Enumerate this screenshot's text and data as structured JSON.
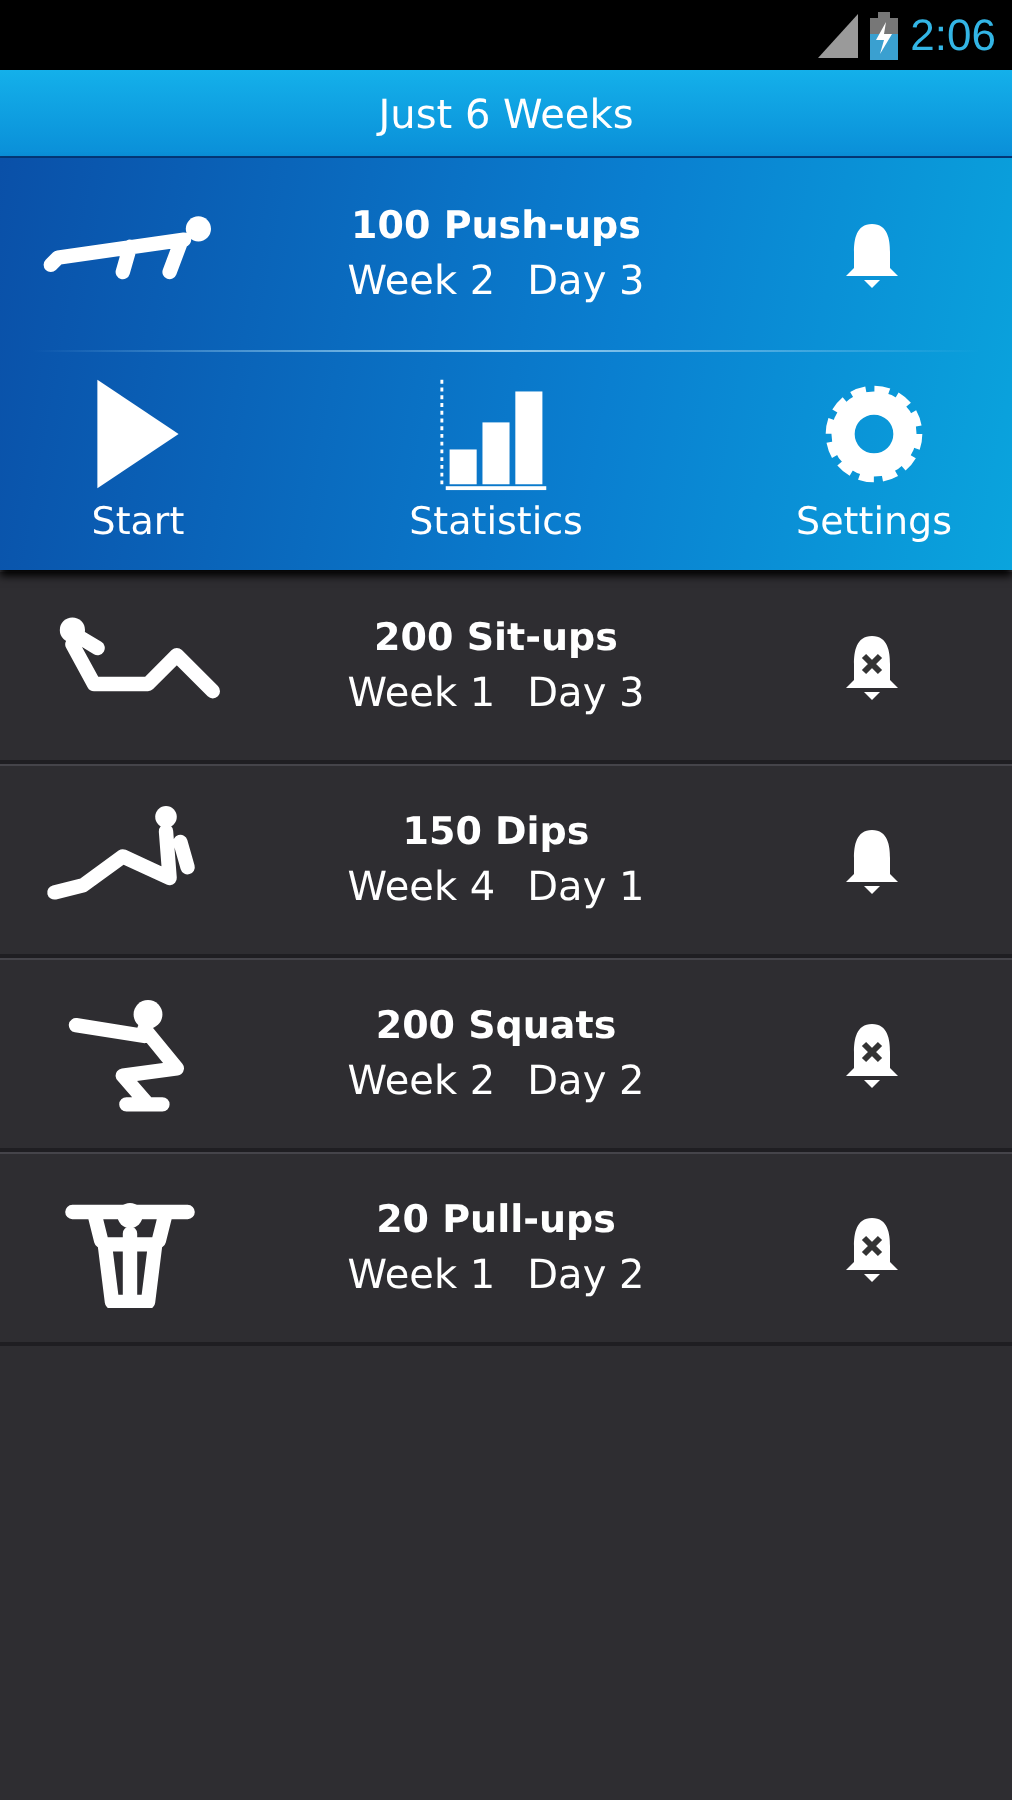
{
  "status_bar": {
    "time": "2:06"
  },
  "title": "Just 6 Weeks",
  "current": {
    "kind": "pushup",
    "name": "100 Push-ups",
    "week": "Week 2",
    "day": "Day 3",
    "reminder": true
  },
  "actions": [
    {
      "kind": "start",
      "label": "Start"
    },
    {
      "kind": "statistics",
      "label": "Statistics"
    },
    {
      "kind": "settings",
      "label": "Settings"
    }
  ],
  "programs": [
    {
      "kind": "situp",
      "name": "200 Sit-ups",
      "week": "Week 1",
      "day": "Day 3",
      "reminder": false
    },
    {
      "kind": "dip",
      "name": "150 Dips",
      "week": "Week 4",
      "day": "Day 1",
      "reminder": true
    },
    {
      "kind": "squat",
      "name": "200 Squats",
      "week": "Week 2",
      "day": "Day 2",
      "reminder": false
    },
    {
      "kind": "pullup",
      "name": "20 Pull-ups",
      "week": "Week 1",
      "day": "Day 2",
      "reminder": false
    }
  ]
}
